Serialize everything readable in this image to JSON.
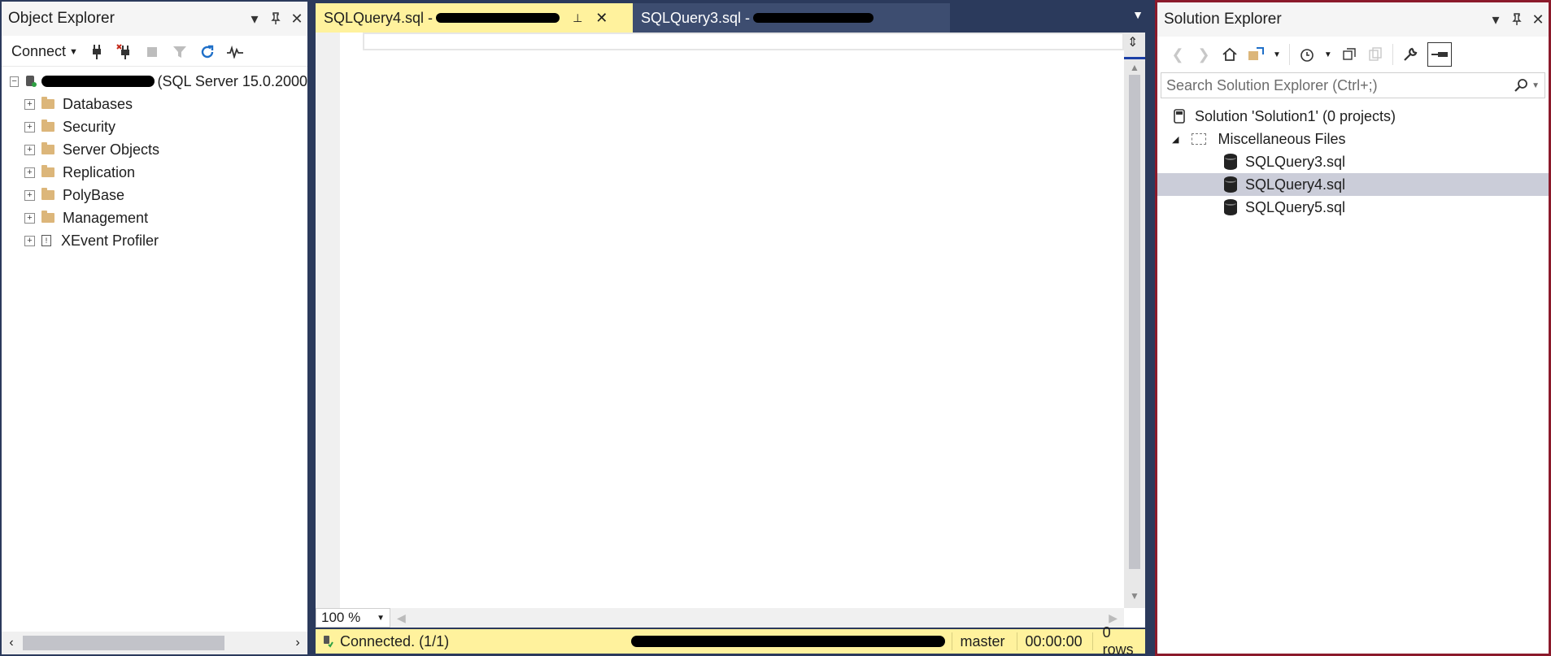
{
  "object_explorer": {
    "title": "Object Explorer",
    "connect_label": "Connect",
    "server_suffix": "(SQL Server 15.0.2000",
    "nodes": [
      {
        "label": "Databases"
      },
      {
        "label": "Security"
      },
      {
        "label": "Server Objects"
      },
      {
        "label": "Replication"
      },
      {
        "label": "PolyBase"
      },
      {
        "label": "Management"
      },
      {
        "label": "XEvent Profiler"
      }
    ]
  },
  "tabs": [
    {
      "title": "SQLQuery4.sql - ",
      "active": true
    },
    {
      "title": "SQLQuery3.sql - ",
      "active": false
    }
  ],
  "editor": {
    "zoom": "100 %"
  },
  "status": {
    "connection": "Connected. (1/1)",
    "database": "master",
    "elapsed": "00:00:00",
    "rows": "0 rows"
  },
  "solution_explorer": {
    "title": "Solution Explorer",
    "search_placeholder": "Search Solution Explorer (Ctrl+;)",
    "solution_label": "Solution 'Solution1' (0 projects)",
    "folder_label": "Miscellaneous Files",
    "files": [
      {
        "label": "SQLQuery3.sql",
        "selected": false
      },
      {
        "label": "SQLQuery4.sql",
        "selected": true
      },
      {
        "label": "SQLQuery5.sql",
        "selected": false
      }
    ]
  },
  "colors": {
    "accent_yellow": "#fff29d",
    "frame_navy": "#2b3a5c",
    "solution_border": "#8b1a2b"
  }
}
